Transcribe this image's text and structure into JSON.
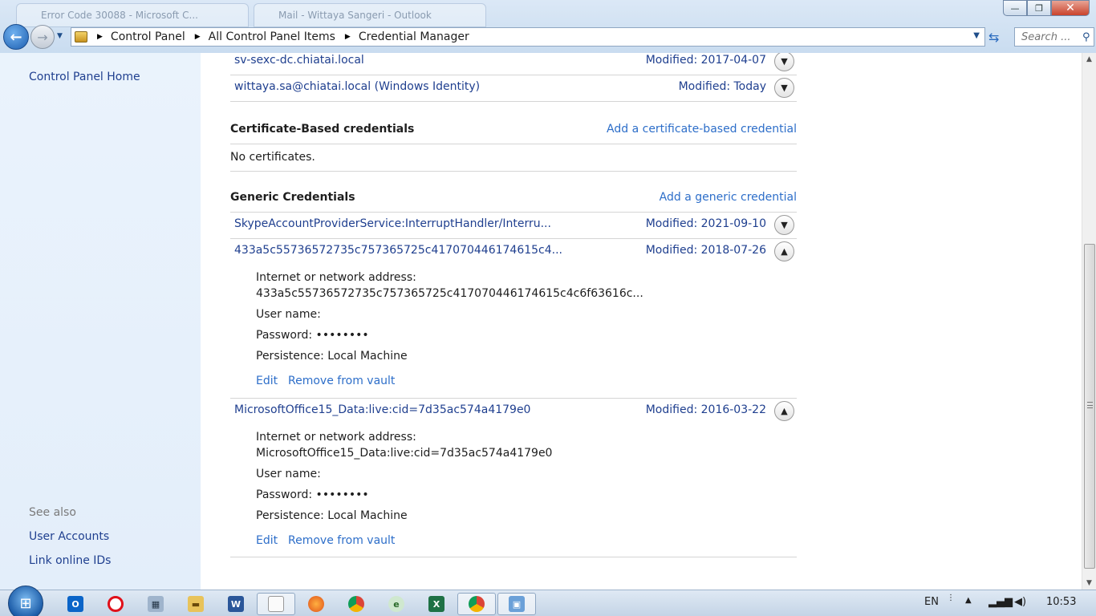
{
  "window": {
    "background_tabs": [
      "Error Code 30088 - Microsoft C...",
      "Mail - Wittaya Sangeri - Outlook"
    ],
    "controls": {
      "minimize": "—",
      "maximize": "❐",
      "close": "✕"
    }
  },
  "address_bar": {
    "breadcrumbs": [
      "Control Panel",
      "All Control Panel Items",
      "Credential Manager"
    ]
  },
  "search": {
    "placeholder": "Search ..."
  },
  "sidebar": {
    "home": "Control Panel Home",
    "see_also_label": "See also",
    "links": [
      "User Accounts",
      "Link online IDs"
    ]
  },
  "windows_credentials": {
    "rows": [
      {
        "name": "sv-sexc-dc.chiatai.local",
        "modified": "Modified:  2017-04-07"
      },
      {
        "name": "wittaya.sa@chiatai.local (Windows Identity)",
        "modified": "Modified:  Today"
      }
    ]
  },
  "certificate_section": {
    "title": "Certificate-Based credentials",
    "action": "Add a certificate-based credential",
    "empty": "No certificates."
  },
  "generic_section": {
    "title": "Generic Credentials",
    "action": "Add a generic credential",
    "rows": [
      {
        "name": "SkypeAccountProviderService:InterruptHandler/Interru...",
        "modified": "Modified:  2021-09-10"
      },
      {
        "name": "433a5c55736572735c757365725c417070446174615c4...",
        "modified": "Modified:  2018-07-26",
        "address_label": "Internet or network address:",
        "address": "433a5c55736572735c757365725c417070446174615c4c6f63616c...",
        "user_label": "User name:",
        "password": "Password:  ••••••••",
        "persistence": "Persistence:  Local Machine",
        "edit": "Edit",
        "remove": "Remove from vault"
      },
      {
        "name": "MicrosoftOffice15_Data:live:cid=7d35ac574a4179e0",
        "modified": "Modified:  2016-03-22",
        "address_label": "Internet or network address:",
        "address": "MicrosoftOffice15_Data:live:cid=7d35ac574a4179e0",
        "user_label": "User name:",
        "password": "Password:  ••••••••",
        "persistence": "Persistence:  Local Machine",
        "edit": "Edit",
        "remove": "Remove from vault"
      }
    ]
  },
  "taskbar": {
    "language": "EN",
    "clock": "10:53"
  }
}
